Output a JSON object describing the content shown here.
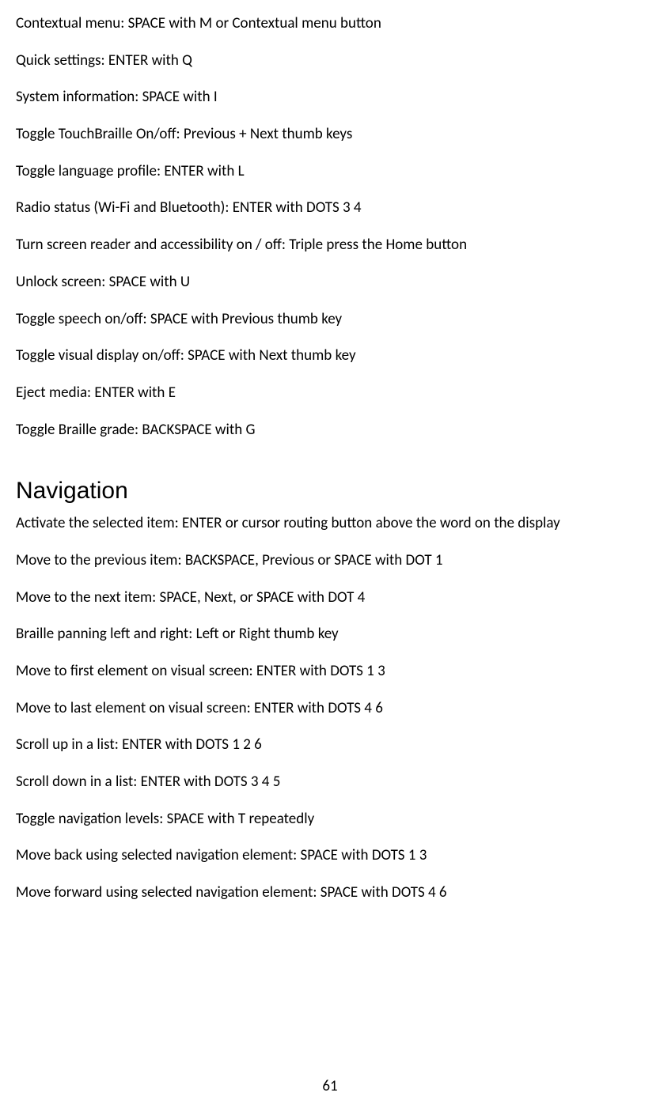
{
  "section1": {
    "items": [
      "Contextual menu: SPACE with M or Contextual menu button",
      "Quick settings: ENTER with Q",
      "System information: SPACE with I",
      "Toggle TouchBraille On/off: Previous + Next thumb keys",
      "Toggle language profile: ENTER with L",
      "Radio status (Wi-Fi and Bluetooth): ENTER with DOTS 3 4",
      "Turn screen reader and accessibility on / off: Triple press the Home button",
      "Unlock screen: SPACE with U",
      "Toggle speech on/off: SPACE with Previous thumb key",
      "Toggle visual display on/off: SPACE with Next thumb key",
      "Eject media: ENTER with E",
      "Toggle Braille grade: BACKSPACE with G"
    ]
  },
  "heading": "Navigation",
  "section2": {
    "items": [
      "Activate the selected item: ENTER or cursor routing button above the word on the display",
      "Move to the previous item: BACKSPACE, Previous or SPACE with DOT 1",
      "Move to the next item: SPACE, Next, or SPACE with DOT 4",
      "Braille panning left and right: Left or Right thumb key",
      "Move to first element on visual screen: ENTER with DOTS 1 3",
      "Move to last element on visual screen: ENTER with DOTS 4 6",
      "Scroll up in a list: ENTER with DOTS 1 2 6",
      "Scroll down in a list: ENTER with DOTS 3 4 5",
      "Toggle navigation levels: SPACE with T repeatedly",
      "Move back using selected navigation element: SPACE with DOTS 1 3",
      "Move forward using selected navigation element: SPACE with DOTS 4 6"
    ]
  },
  "pageNumber": "61"
}
